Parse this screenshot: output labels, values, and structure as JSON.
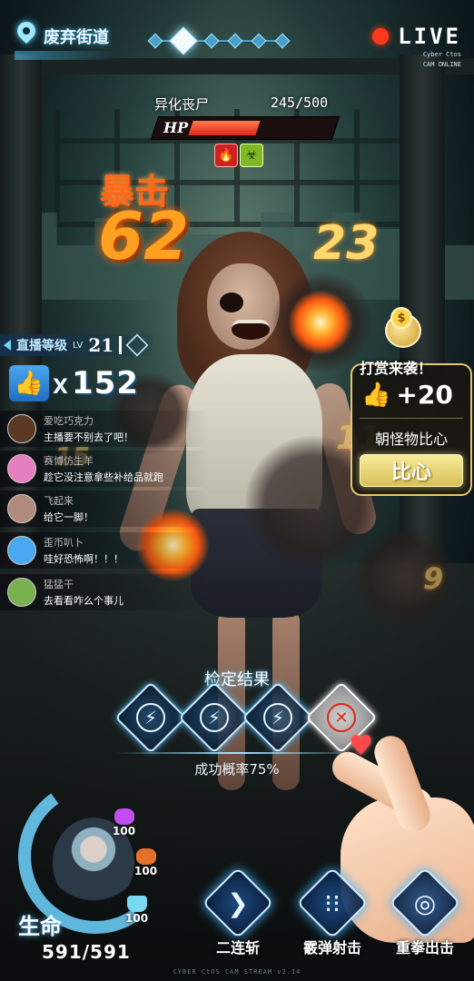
{
  "location": {
    "name": "废弃街道",
    "icon": "map-pin-icon"
  },
  "stage_progress": {
    "total": 6,
    "current": 2
  },
  "live": {
    "label": "LIVE",
    "sub1": "Cyber Ctos",
    "sub2": "CAM ONLINE"
  },
  "enemy": {
    "name": "异化丧尸",
    "hp_text": "245/500",
    "hp_current": 245,
    "hp_max": 500,
    "hp_label": "HP",
    "status_icons": [
      "fire-status-icon",
      "biohazard-status-icon"
    ]
  },
  "damage": {
    "crit_label": "暴击",
    "crit_value": "62",
    "values": [
      "23",
      "11",
      "15",
      "9"
    ]
  },
  "stream": {
    "level_label": "直播等级",
    "level_prefix": "LV",
    "level": "21"
  },
  "likes": {
    "x": "X",
    "count": "152"
  },
  "chat": [
    {
      "user": "爱吃巧克力",
      "message": "主播要不别去了吧！",
      "avatar_color": "#5a3a24"
    },
    {
      "user": "赛博仿生羊",
      "message": "趁它没注意拿些补给品就跑",
      "avatar_color": "#e67fc0"
    },
    {
      "user": "飞起来",
      "message": "给它一脚！",
      "avatar_color": "#b08a7a"
    },
    {
      "user": "歪币叭卜",
      "message": "哇好恐怖啊！！！",
      "avatar_color": "#4aa8f0"
    },
    {
      "user": "猛猛干",
      "message": "去看看咋么个事儿",
      "avatar_color": "#7ab050"
    }
  ],
  "tip": {
    "title": "打赏来袭！",
    "coin_symbol": "$",
    "likes": "+20",
    "action": "朝怪物比心",
    "button": "比心"
  },
  "check": {
    "title": "检定结果",
    "results": [
      "success",
      "success",
      "success",
      "fail"
    ],
    "success_rate_text": "成功概率75%"
  },
  "player": {
    "life_label": "生命",
    "life_value": "591/591",
    "brain": "100",
    "stomach": "100",
    "water": "100"
  },
  "skills": [
    {
      "label": "二连斩",
      "icon": "double-slash-icon"
    },
    {
      "label": "霰弹射击",
      "icon": "shotgun-shells-icon"
    },
    {
      "label": "重拳出击",
      "icon": "brass-knuckles-icon"
    }
  ],
  "footer": "CYBER CtOS CAM STREAM v2.14",
  "colors": {
    "accent": "#4fc3ff",
    "crit": "#ff6a1a",
    "tip_gold": "#e8c66a",
    "hp_red": "#e0261a"
  }
}
